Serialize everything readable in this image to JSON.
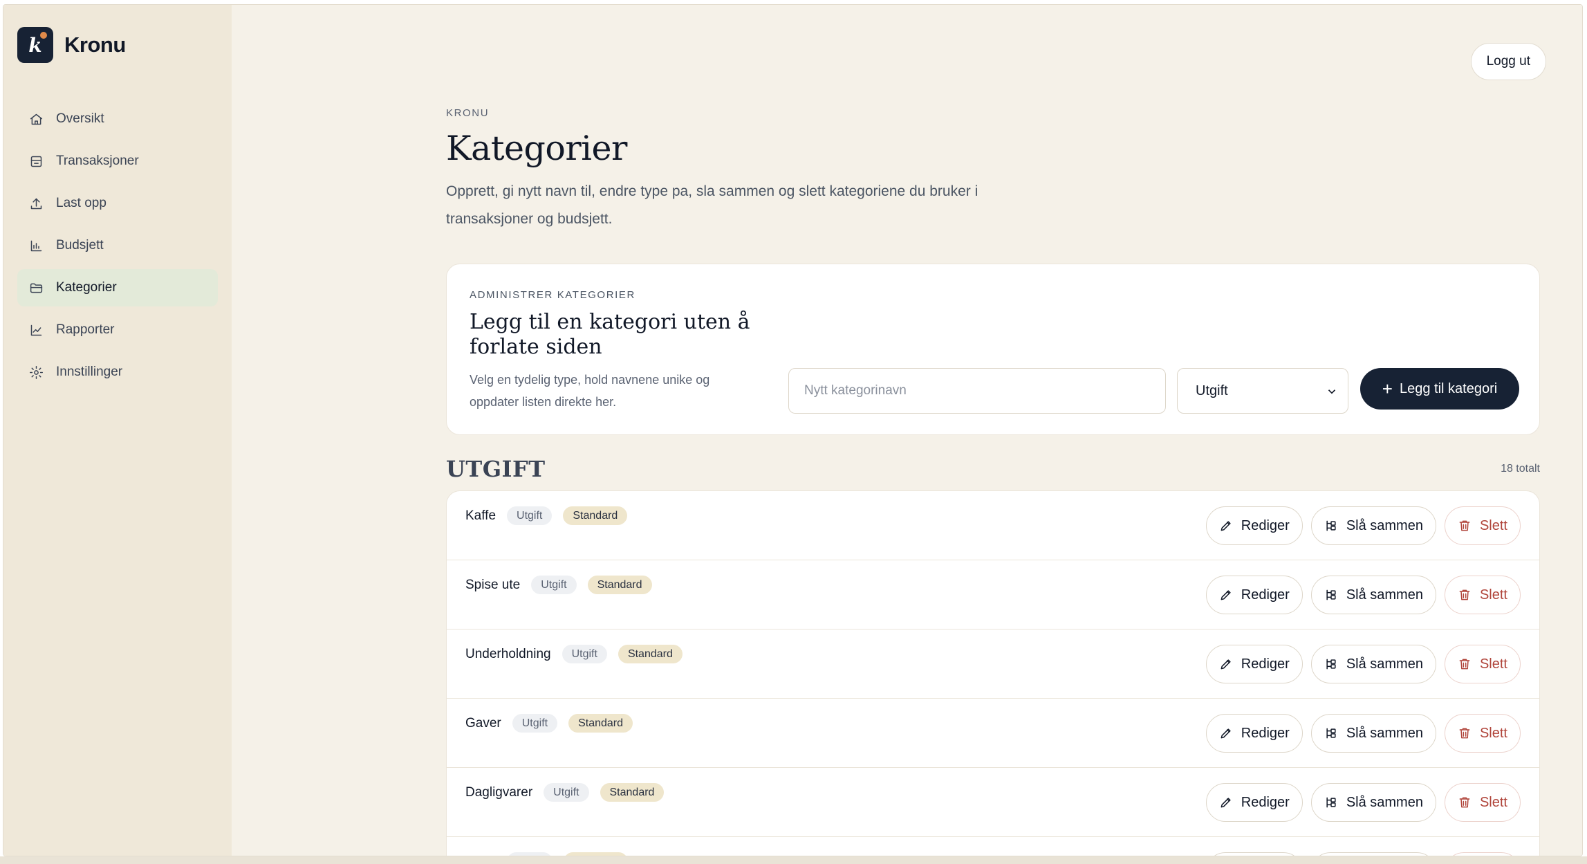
{
  "brand": {
    "logo_letter": "k",
    "name": "Kronu"
  },
  "sidebar": {
    "items": [
      {
        "label": "Oversikt",
        "icon": "home-icon",
        "active": false
      },
      {
        "label": "Transaksjoner",
        "icon": "receipt-icon",
        "active": false
      },
      {
        "label": "Last opp",
        "icon": "upload-icon",
        "active": false
      },
      {
        "label": "Budsjett",
        "icon": "bar-chart-icon",
        "active": false
      },
      {
        "label": "Kategorier",
        "icon": "folder-icon",
        "active": true
      },
      {
        "label": "Rapporter",
        "icon": "line-chart-icon",
        "active": false
      },
      {
        "label": "Innstillinger",
        "icon": "gear-icon",
        "active": false
      }
    ]
  },
  "header": {
    "logout_label": "Logg ut"
  },
  "page": {
    "eyebrow": "KRONU",
    "title": "Kategorier",
    "description": "Opprett, gi nytt navn til, endre type pa, sla sammen og slett kategoriene du bruker i transaksjoner og budsjett."
  },
  "manage": {
    "eyebrow": "ADMINISTRER KATEGORIER",
    "title": "Legg til en kategori uten å forlate siden",
    "description": "Velg en tydelig type, hold navnene unike og oppdater listen direkte her.",
    "name_placeholder": "Nytt kategorinavn",
    "name_value": "",
    "type_selected": "Utgift",
    "add_label": "Legg til kategori"
  },
  "section": {
    "title": "UTGIFT",
    "count": "18 totalt"
  },
  "actions": {
    "edit": "Rediger",
    "merge": "Slå sammen",
    "delete": "Slett"
  },
  "categories": [
    {
      "name": "Kaffe",
      "type": "Utgift",
      "tag": "Standard"
    },
    {
      "name": "Spise ute",
      "type": "Utgift",
      "tag": "Standard"
    },
    {
      "name": "Underholdning",
      "type": "Utgift",
      "tag": "Standard"
    },
    {
      "name": "Gaver",
      "type": "Utgift",
      "tag": "Standard"
    },
    {
      "name": "Dagligvarer",
      "type": "Utgift",
      "tag": "Standard"
    },
    {
      "name": "Hjem",
      "type": "Utgift",
      "tag": "Standard"
    }
  ],
  "colors": {
    "accent": "#172234",
    "sidebar": "#efe8d9",
    "background": "#f5f1e8",
    "danger": "#b0443a",
    "active_nav": "#e3ead9"
  }
}
